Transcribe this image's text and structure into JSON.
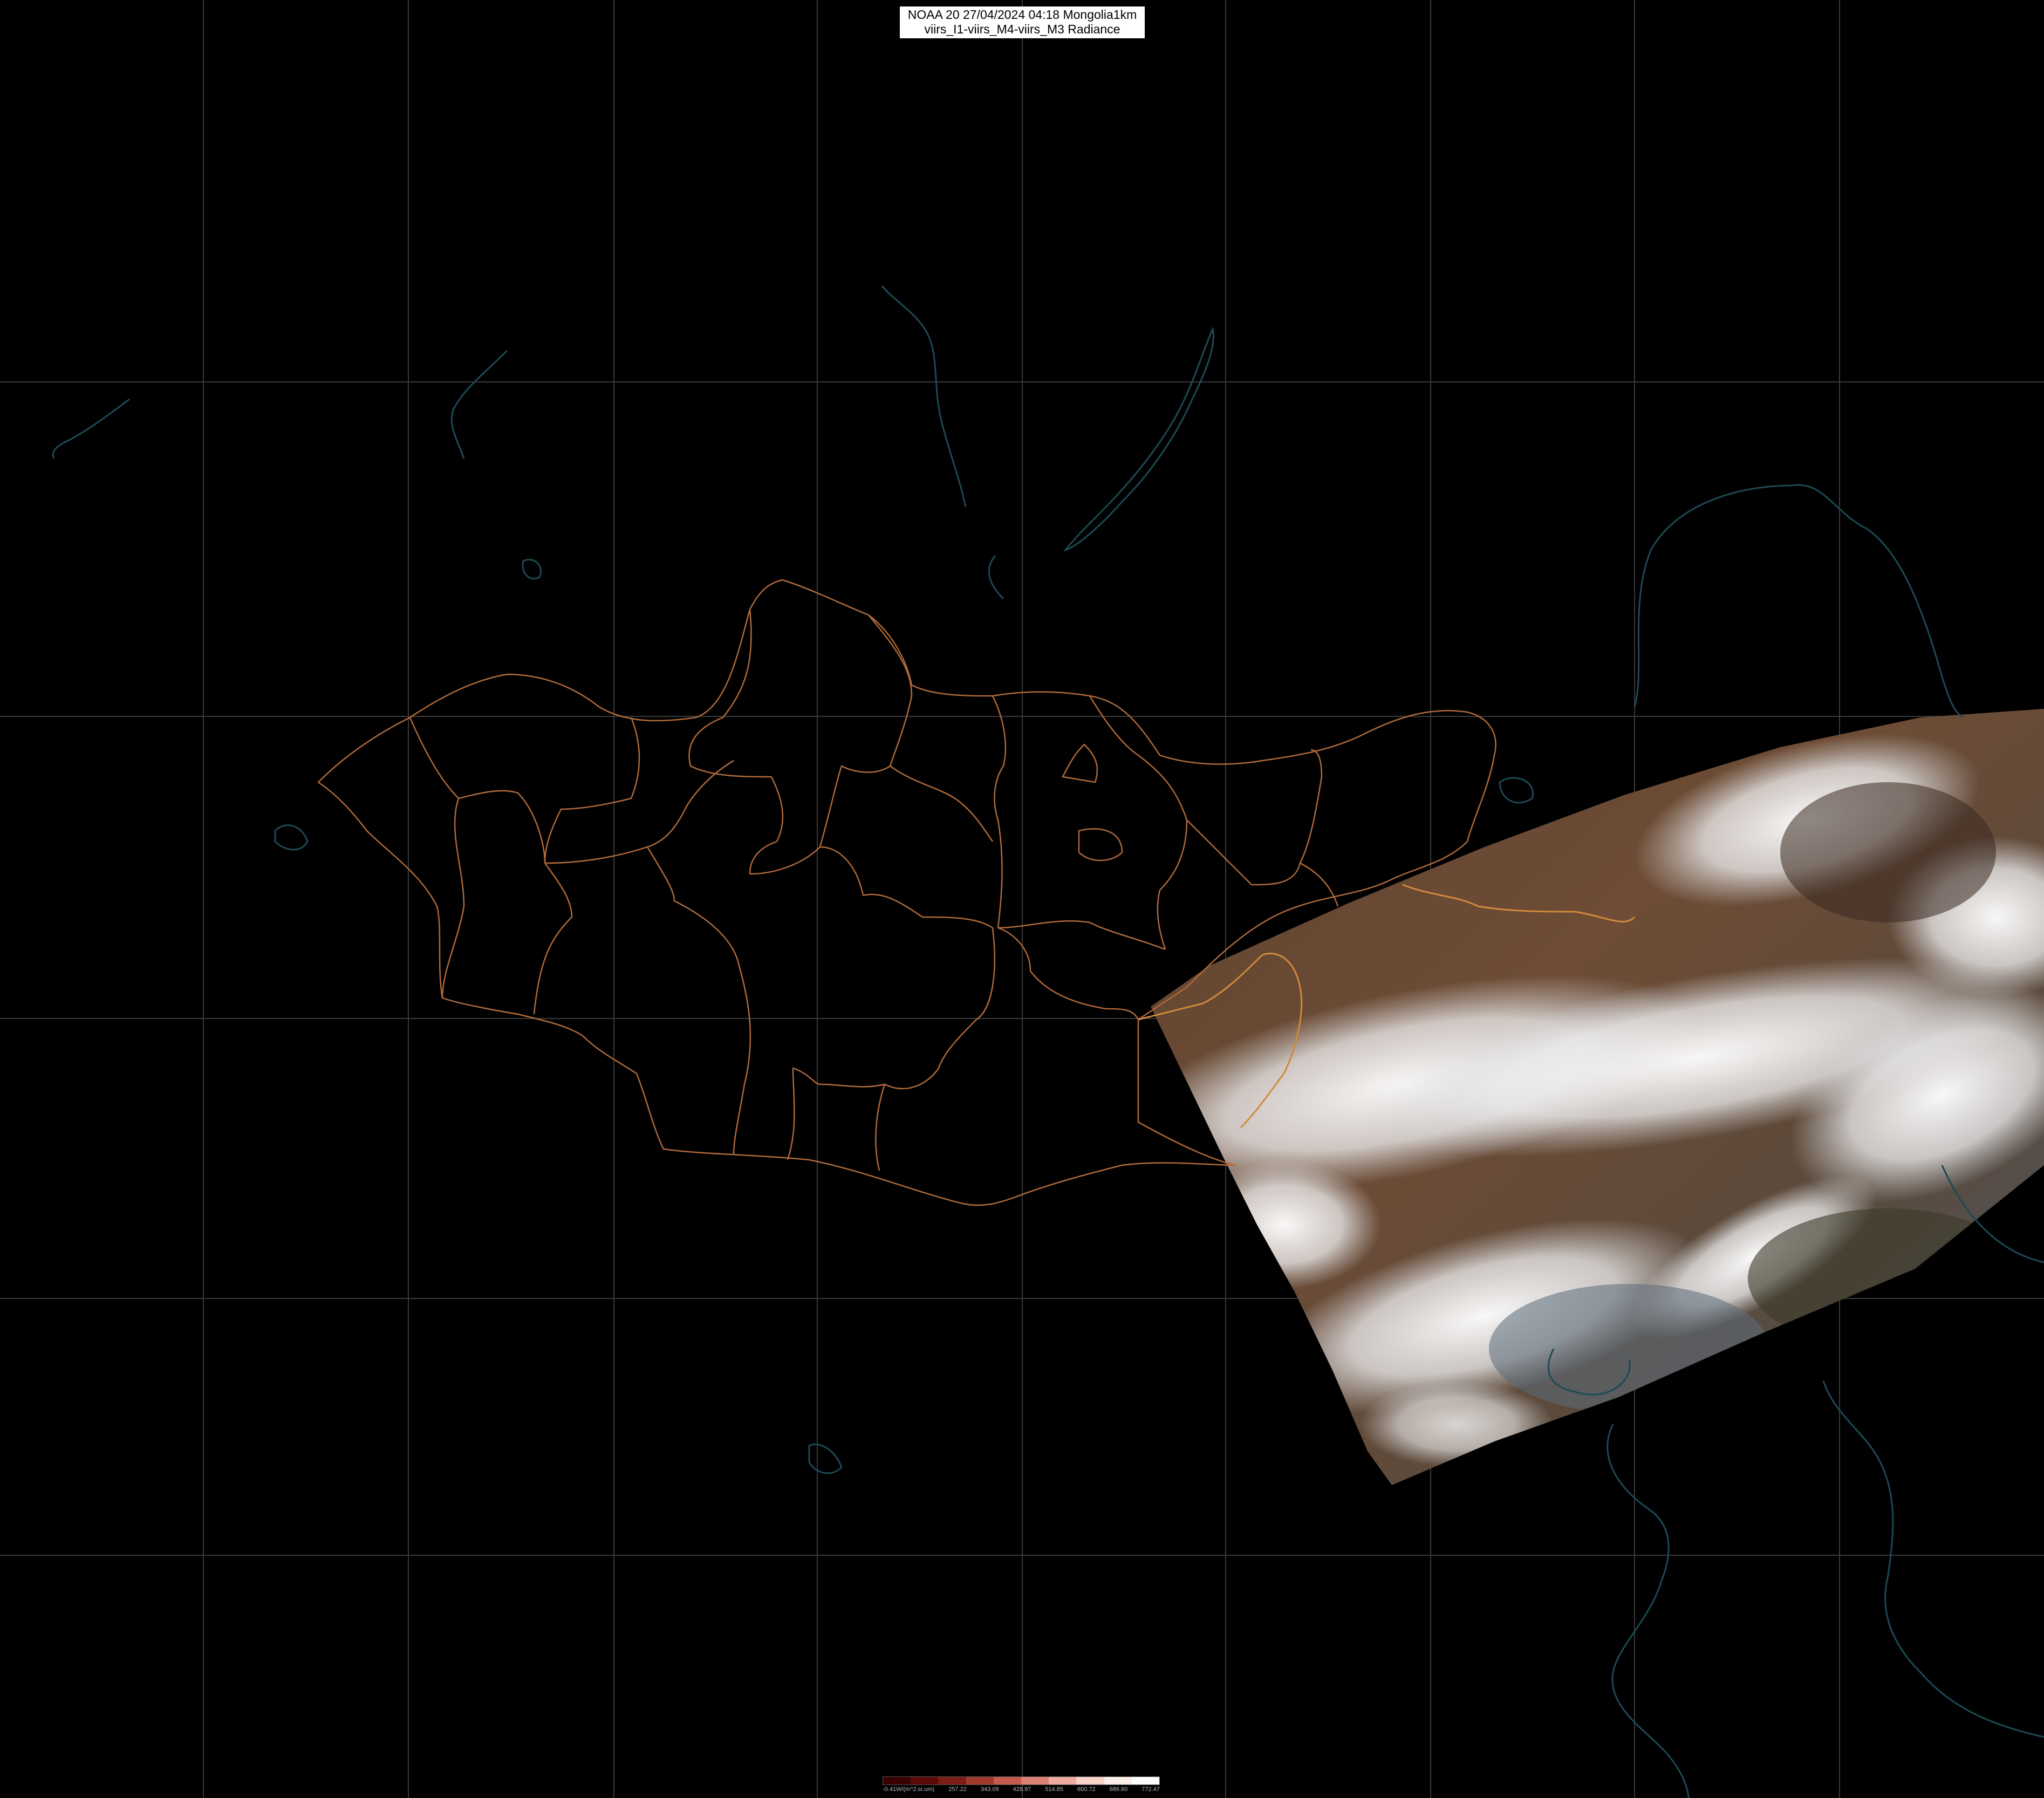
{
  "title": {
    "line1": "NOAA 20 27/04/2024 04:18 Mongolia1km",
    "line2": "viirs_I1-viirs_M4-viirs_M3 Radiance"
  },
  "colorbar": {
    "unit_label": "-0.41W/(m^2.sr.um)",
    "tick_labels": [
      "257.22",
      "343.09",
      "428.97",
      "514.85",
      "600.72",
      "686.60",
      "772.47"
    ],
    "colors": [
      "#3a0000",
      "#5c0a08",
      "#7e1d16",
      "#a03a2e",
      "#c25a4d",
      "#dc8273",
      "#eeaa9e",
      "#f8d1c9",
      "#fdeee9",
      "#ffffff"
    ]
  },
  "map": {
    "background_color": "#000000",
    "graticule_color": "#3a3a3a",
    "admin_border_color": "#b06a3a",
    "coastline_color": "#1c4a55",
    "swath_land_color": "#6b4a34",
    "swath_cloud_color": "#e8e8ea",
    "swath_sea_color": "#4a5a68"
  }
}
